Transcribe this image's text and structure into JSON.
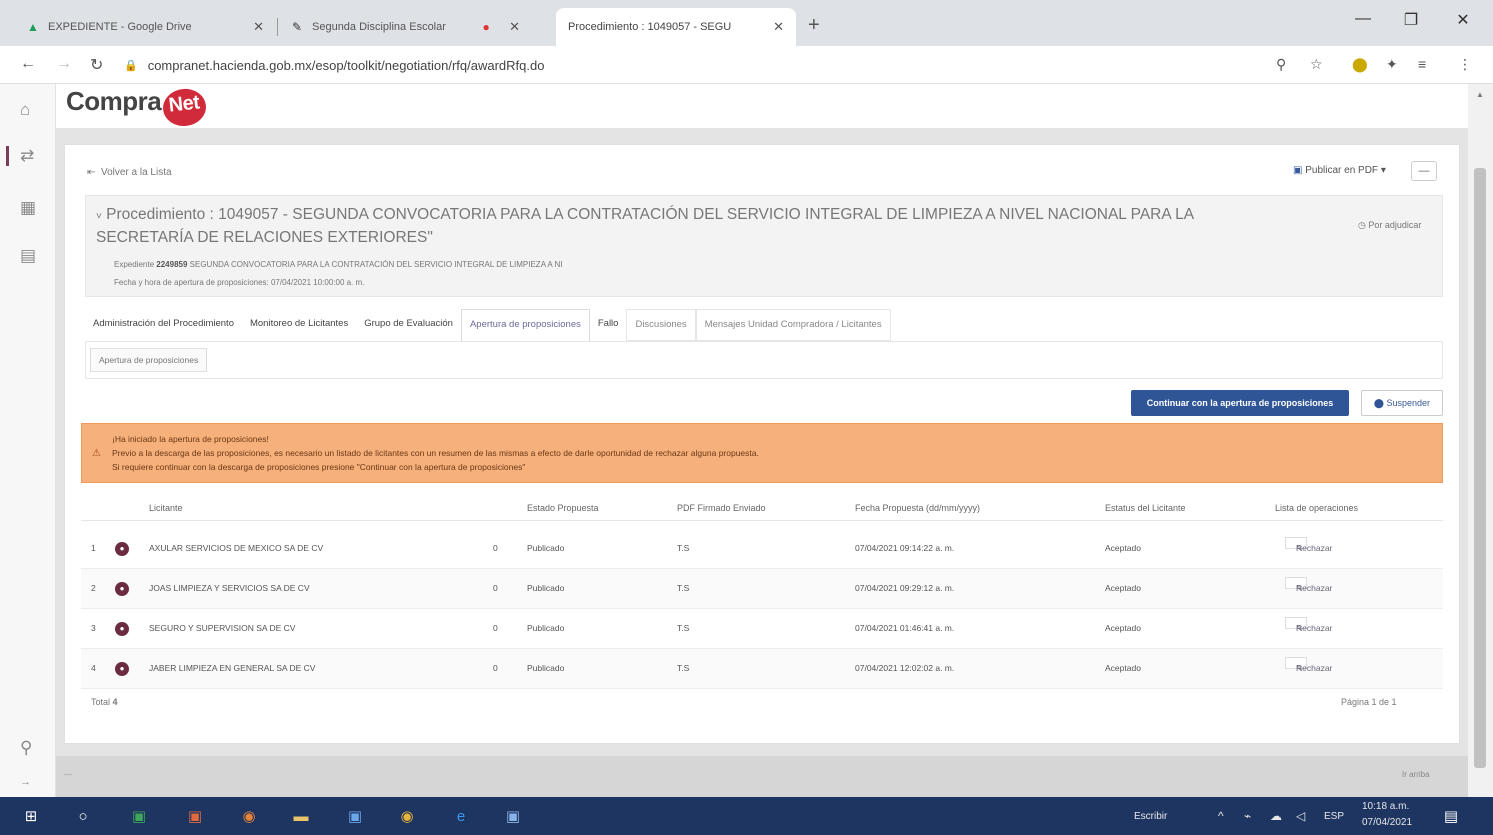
{
  "browser": {
    "tabs": [
      {
        "title": "EXPEDIENTE - Google Drive",
        "icon": "drive-icon",
        "active": false
      },
      {
        "title": "Segunda Disciplina Escolar",
        "icon": "pen-icon",
        "active": false
      },
      {
        "title": "Procedimiento : 1049057 - SEGU",
        "icon": "page-icon",
        "active": true
      }
    ],
    "new_tab": "+",
    "window_controls": [
      "—",
      "❐",
      "✕"
    ],
    "url": "compranet.hacienda.gob.mx/esop/toolkit/negotiation/rfq/awardRfq.do"
  },
  "sidebar_icons": [
    "home-icon",
    "handshake-icon",
    "building-icon",
    "document-icon",
    "search-icon"
  ],
  "brand": {
    "name": "Compra",
    "badge": "Net"
  },
  "toolbar": {
    "back_label": "Volver a la Lista",
    "pdf_label": "Publicar en PDF",
    "more_label": "—"
  },
  "procedure": {
    "title": "Procedimiento : 1049057 - SEGUNDA CONVOCATORIA PARA LA CONTRATACIÓN DEL SERVICIO INTEGRAL DE LIMPIEZA A NIVEL NACIONAL PARA LA SECRETARÍA DE RELACIONES EXTERIORES\"",
    "expediente_label": "Expediente",
    "expediente_value": "2249859",
    "expediente_desc": "SEGUNDA CONVOCATORIA PARA LA CONTRATACIÓN DEL SERVICIO INTEGRAL DE LIMPIEZA A NI",
    "date_line": "Fecha y hora de apertura de proposiciones: 07/04/2021 10:00:00 a. m.",
    "side_label": "Por adjudicar"
  },
  "process_tabs": [
    "Administración del Procedimiento",
    "Monitoreo de Licitantes",
    "Grupo de Evaluación",
    "Apertura de proposiciones",
    "Fallo",
    "Discusiones",
    "Mensajes Unidad Compradora / Licitantes"
  ],
  "subtab": "Apertura de proposiciones",
  "actions": {
    "primary": "Continuar con la apertura de proposiciones",
    "suspend": "Suspender"
  },
  "alert": {
    "line1": "¡Ha iniciado la apertura de proposiciones!",
    "line2": "Previo a la descarga de las proposiciones, es necesario un listado de licitantes con un resumen de las mismas a efecto de darle oportunidad de rechazar alguna propuesta.",
    "line3": "Si requiere continuar con la descarga de proposiciones presione \"Continuar con la apertura de proposiciones\""
  },
  "table": {
    "headers": [
      "Licitante",
      "",
      "Estado Propuesta",
      "PDF Firmado Enviado",
      "Fecha Propuesta (dd/mm/yyyy)",
      "Estatus del Licitante",
      "Lista de operaciones"
    ],
    "rows": [
      {
        "n": "1",
        "name": "AXULAR SERVICIOS DE MEXICO SA DE CV",
        "count": "0",
        "estado": "Publicado",
        "pdf": "T.S",
        "fecha": "07/04/2021 09:14:22 a. m.",
        "estatus": "Aceptado",
        "action": "Rechazar"
      },
      {
        "n": "2",
        "name": "JOAS LIMPIEZA Y SERVICIOS SA DE CV",
        "count": "0",
        "estado": "Publicado",
        "pdf": "T.S",
        "fecha": "07/04/2021 09:29:12 a. m.",
        "estatus": "Aceptado",
        "action": "Rechazar"
      },
      {
        "n": "3",
        "name": "SEGURO Y SUPERVISION SA DE CV",
        "count": "0",
        "estado": "Publicado",
        "pdf": "T.S",
        "fecha": "07/04/2021 01:46:41 a. m.",
        "estatus": "Aceptado",
        "action": "Rechazar"
      },
      {
        "n": "4",
        "name": "JABER LIMPIEZA EN GENERAL SA DE CV",
        "count": "0",
        "estado": "Publicado",
        "pdf": "T.S",
        "fecha": "07/04/2021 12:02:02 a. m.",
        "estatus": "Aceptado",
        "action": "Rechazar"
      }
    ],
    "total_label": "Total",
    "total_value": "4",
    "page_label": "Página 1 de 1"
  },
  "bottom_band": {
    "left": "—",
    "right": "Ir arriba"
  },
  "taskbar": {
    "search_text": "Escribir",
    "lang": "ESP",
    "time": "10:18 a.m.",
    "date": "07/04/2021"
  },
  "colors": {
    "primary": "#2f5596",
    "alert": "#f6b07c",
    "taskbar": "#1d3560",
    "brand": "#d12a3a"
  }
}
